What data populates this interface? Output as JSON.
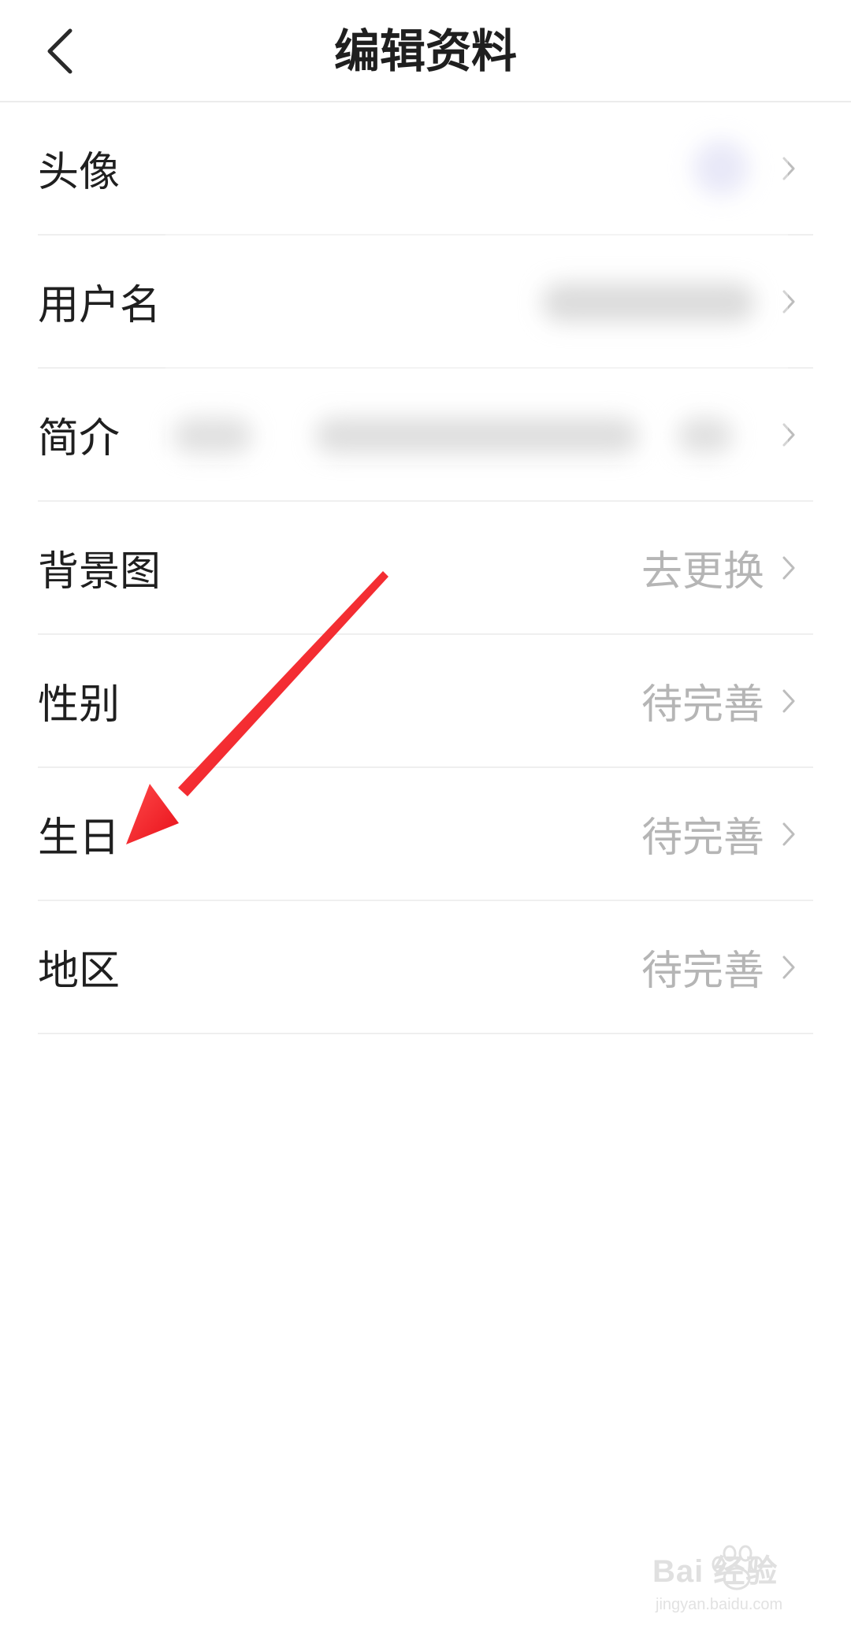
{
  "header": {
    "title": "编辑资料",
    "back_icon": "chevron-left-icon"
  },
  "rows": [
    {
      "label": "头像",
      "value": ""
    },
    {
      "label": "用户名",
      "value": ""
    },
    {
      "label": "简介",
      "value": ""
    },
    {
      "label": "背景图",
      "value": "去更换"
    },
    {
      "label": "性别",
      "value": "待完善"
    },
    {
      "label": "生日",
      "value": "待完善"
    },
    {
      "label": "地区",
      "value": "待完善"
    }
  ],
  "annotation": {
    "arrow_color": "#e8101a"
  },
  "watermark": {
    "logo": "Bai 经验",
    "url": "jingyan.baidu.com"
  },
  "colors": {
    "label": "#1f1f1f",
    "value": "#b5b5b5",
    "divider": "#efefef"
  }
}
